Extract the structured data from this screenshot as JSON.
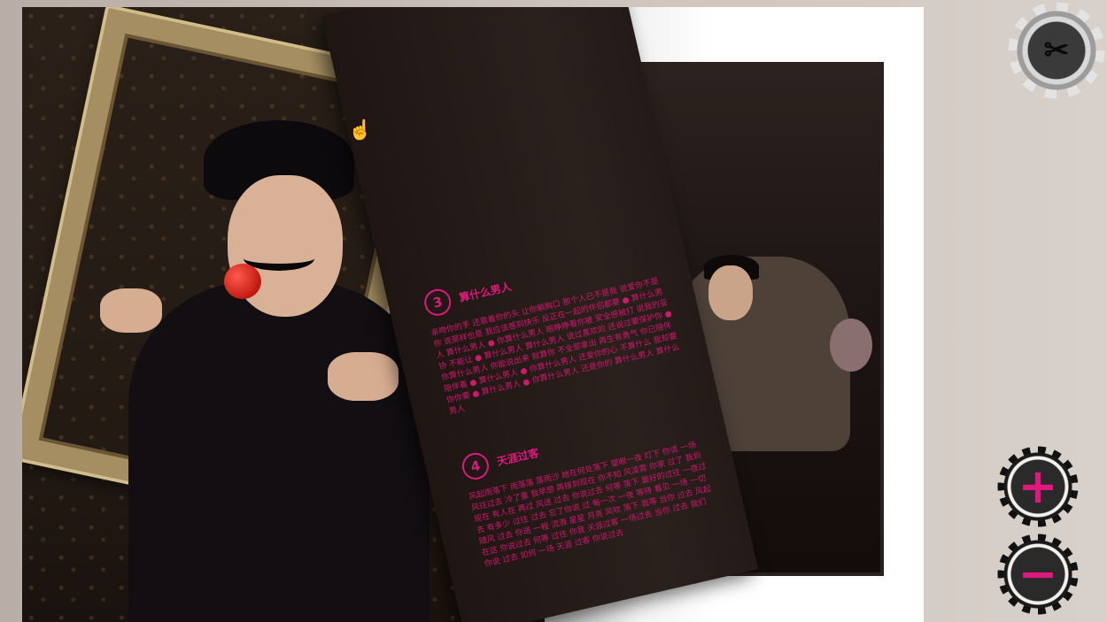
{
  "toolbar": {
    "settings_icon": "crossed-tools-icon",
    "zoom_in_icon": "plus-icon",
    "zoom_out_icon": "minus-icon",
    "zoom_in_symbol": "+",
    "zoom_out_symbol": "−",
    "accent_color": "#e0187e"
  },
  "magazine": {
    "sections": [
      {
        "number": "3",
        "title": "算什么男人",
        "body": "亲吻你的手 还靠着你的头 让你躺胸口 那个人已不是我 说爱你不是你 说那样也是 我应该感到快乐 反正在一起的伴侣都要 ● 算什么男人 算什么男人 ● 你算什么男人 眼睁睁看你被 安全感被打 说我的妥协 不能让 ● 算什么男人 算什么男人 说过喜欢的 还说过要保护你 ● 你算什么男人 你能说出来 就算你 不全部拿出 再生有勇气 你已陪伴陪伴着 ● 算什么男人 ● 你算什么男人 还爱你的心 不算什么 我却要你你要 ● 算什么男人 ● 你算什么男人 还是你的 算什么男人 算什么男人"
      },
      {
        "number": "4",
        "title": "天涯过客",
        "body": "风起雨落下 雨落落 落雨沙 她在何处落下 望眼一夜 灯下 你说 一场 风往过去 冷了重 我早想 再接到现在 你不知 风凌霄 你家 过了 我到现在 有人在 再过 风送 过去 你说过去 何等 落下 最好的过往 一夜过去 有多少 过往 过去 忘了你说 过 每一次 一夜 等待 看见 一场 一切随风 过去 你送 一程 流浪 星星 月亮 风吹 落下 我等 当你 过去 风起 在这 你说过去 何等 过往 你我 天涯过客 一场过去 当你 过去 我们 你说 过去 如何 一场 天涯 过客 你说过去"
      }
    ]
  }
}
